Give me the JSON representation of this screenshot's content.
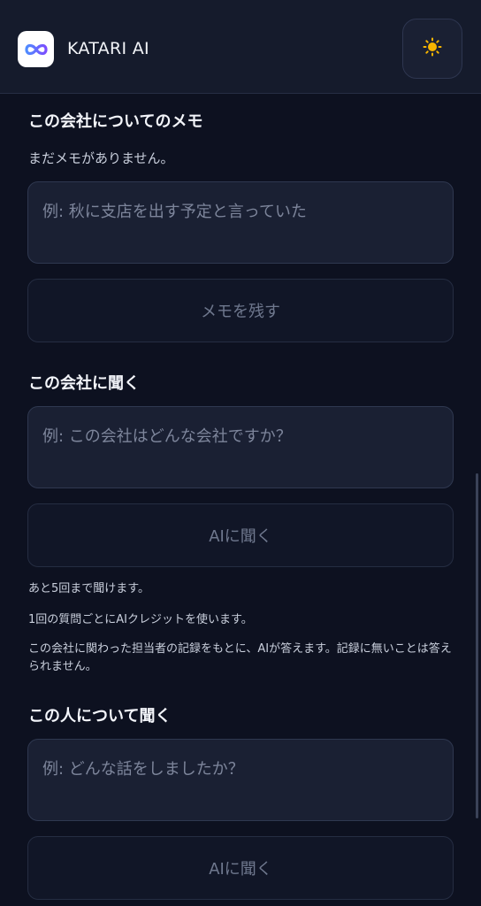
{
  "header": {
    "app_title": "KATARI AI",
    "logo_icon": "infinity-logo-icon",
    "theme_icon": "sun-icon"
  },
  "memo": {
    "heading": "この会社についてのメモ",
    "empty_text": "まだメモがありません。",
    "input_placeholder": "例: 秋に支店を出す予定と言っていた",
    "button_label": "メモを残す"
  },
  "ask_company": {
    "heading": "この会社に聞く",
    "input_placeholder": "例: この会社はどんな会社ですか？",
    "button_label": "AIに聞く",
    "remaining_text": "あと5回まで聞けます。",
    "credit_text": "1回の質問ごとにAIクレジットを使います。",
    "info_text": "この会社に関わった担当者の記録をもとに、AIが答えます。記録に無いことは答えられません。"
  },
  "ask_person": {
    "heading": "この人について聞く",
    "input_placeholder": "例: どんな話をしましたか？",
    "button_label": "AIに聞く"
  },
  "colors": {
    "background": "#0d1120",
    "header": "#151b2c",
    "field": "#1a2033",
    "sun": "#f7b500"
  }
}
